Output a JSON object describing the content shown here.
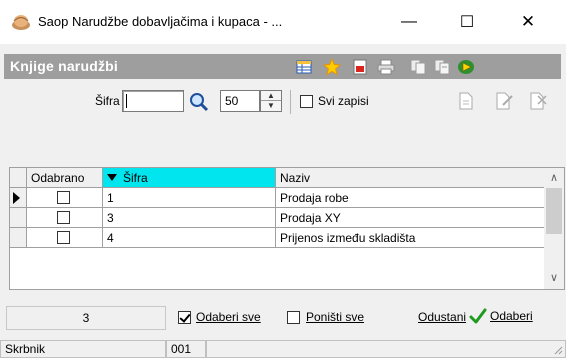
{
  "window": {
    "title": "Saop  Narudžbe dobavljačima i kupaca - ...",
    "minimize": "—",
    "maximize": "☐",
    "close": "✕"
  },
  "section": {
    "title": "Knjige narudžbi"
  },
  "filter": {
    "sifra_label": "Šifra",
    "sifra_value": "",
    "count_value": "50",
    "show_all_label": "Svi zapisi",
    "show_all_checked": false
  },
  "table": {
    "columns": [
      "Odabrano",
      "Šifra",
      "Naziv"
    ],
    "rows": [
      {
        "selected": false,
        "sifra": "1",
        "naziv": "Prodaja robe"
      },
      {
        "selected": false,
        "sifra": "3",
        "naziv": "Prodaja XY"
      },
      {
        "selected": false,
        "sifra": "4",
        "naziv": "Prijenos između skladišta"
      }
    ]
  },
  "bottom": {
    "count": "3",
    "select_all_label": "Odaberi sve",
    "select_all_checked": true,
    "unselect_all_label": "Poništi sve",
    "unselect_all_checked": false,
    "cancel_label": "Odustani",
    "ok_label": "Odaberi"
  },
  "status": {
    "user": "Skrbnik",
    "code": "001"
  },
  "colors": {
    "active_header": "#00e5ee",
    "section_bar": "#9e9e9e"
  }
}
